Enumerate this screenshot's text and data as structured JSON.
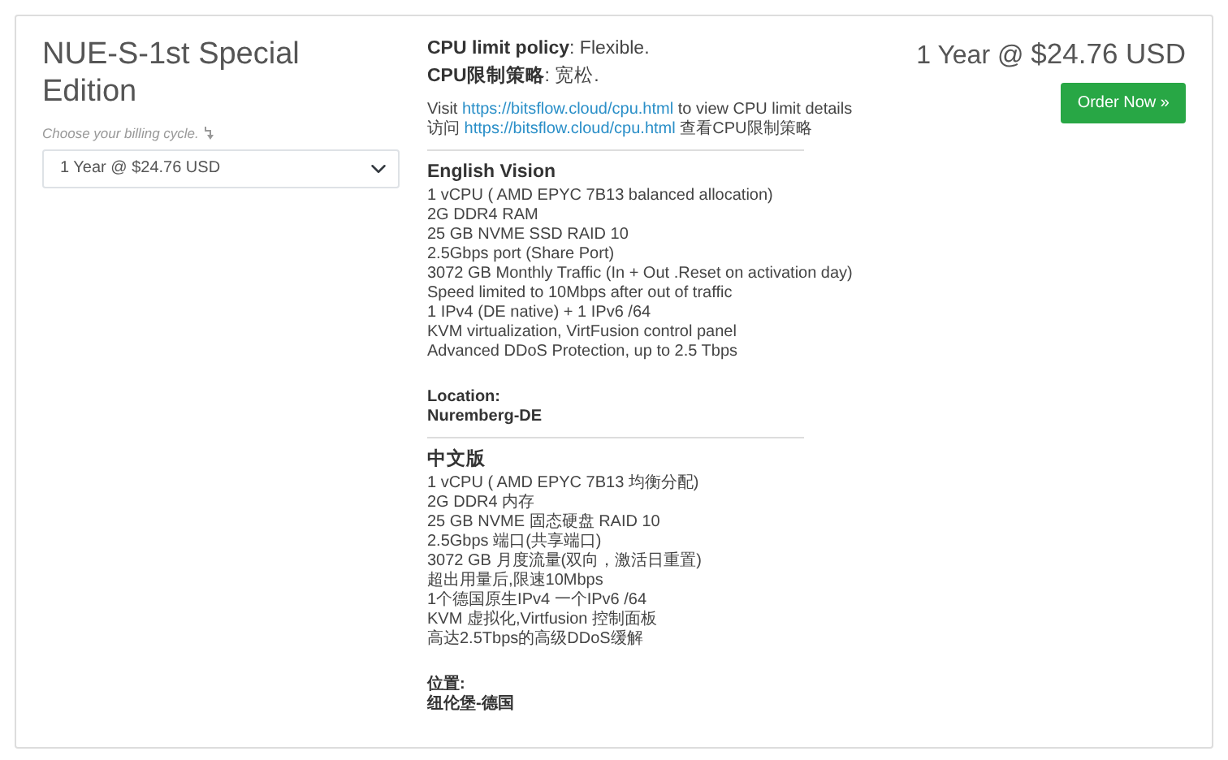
{
  "product": {
    "title": "NUE-S-1st Special Edition",
    "billing_hint": "Choose your billing cycle.",
    "billing_select": "1 Year @ $24.76 USD"
  },
  "policies": [
    "**CPU limit policy**: Flexible.",
    "**CPU限制策略**: 宽松."
  ],
  "notes": [
    {
      "before": "Visit",
      "link": "https://bitsflow.cloud/cpu.html",
      "after": "to view CPU limit details"
    },
    {
      "before": "访问",
      "link": "https://bitsflow.cloud/cpu.html",
      "after": "查看CPU限制策略"
    }
  ],
  "sections": [
    {
      "heading": "English Vision",
      "lines": [
        "1 vCPU ( AMD EPYC 7B13 balanced allocation)",
        "2G DDR4 RAM",
        "25 GB NVME SSD RAID 10",
        "2.5Gbps port (Share Port)",
        "3072 GB Monthly Traffic (In + Out .Reset on activation day)",
        "Speed limited to 10Mbps after out of traffic",
        "1 IPv4 (DE native) + 1 IPv6 /64",
        "KVM virtualization, VirtFusion control panel",
        "Advanced DDoS Protection, up to 2.5 Tbps"
      ],
      "location_label": "Location:",
      "location": "Nuremberg-DE"
    },
    {
      "heading": "中文版",
      "lines": [
        "1 vCPU ( AMD EPYC 7B13 均衡分配)",
        "2G DDR4 内存",
        "25 GB NVME 固态硬盘 RAID 10",
        "2.5Gbps 端口(共享端口)",
        "3072 GB 月度流量(双向，激活日重置)",
        "超出用量后,限速10Mbps",
        "1个德国原生IPv4 一个IPv6 /64",
        "KVM 虚拟化,Virtfusion 控制面板",
        "高达2.5Tbps的高级DDoS缓解"
      ],
      "location_label": "位置:",
      "location": "纽伦堡-德国"
    }
  ],
  "price": {
    "term": "1 Year @",
    "amount": "$24.76 USD"
  },
  "order_button": {
    "label": "Order Now",
    "icon": "»"
  }
}
